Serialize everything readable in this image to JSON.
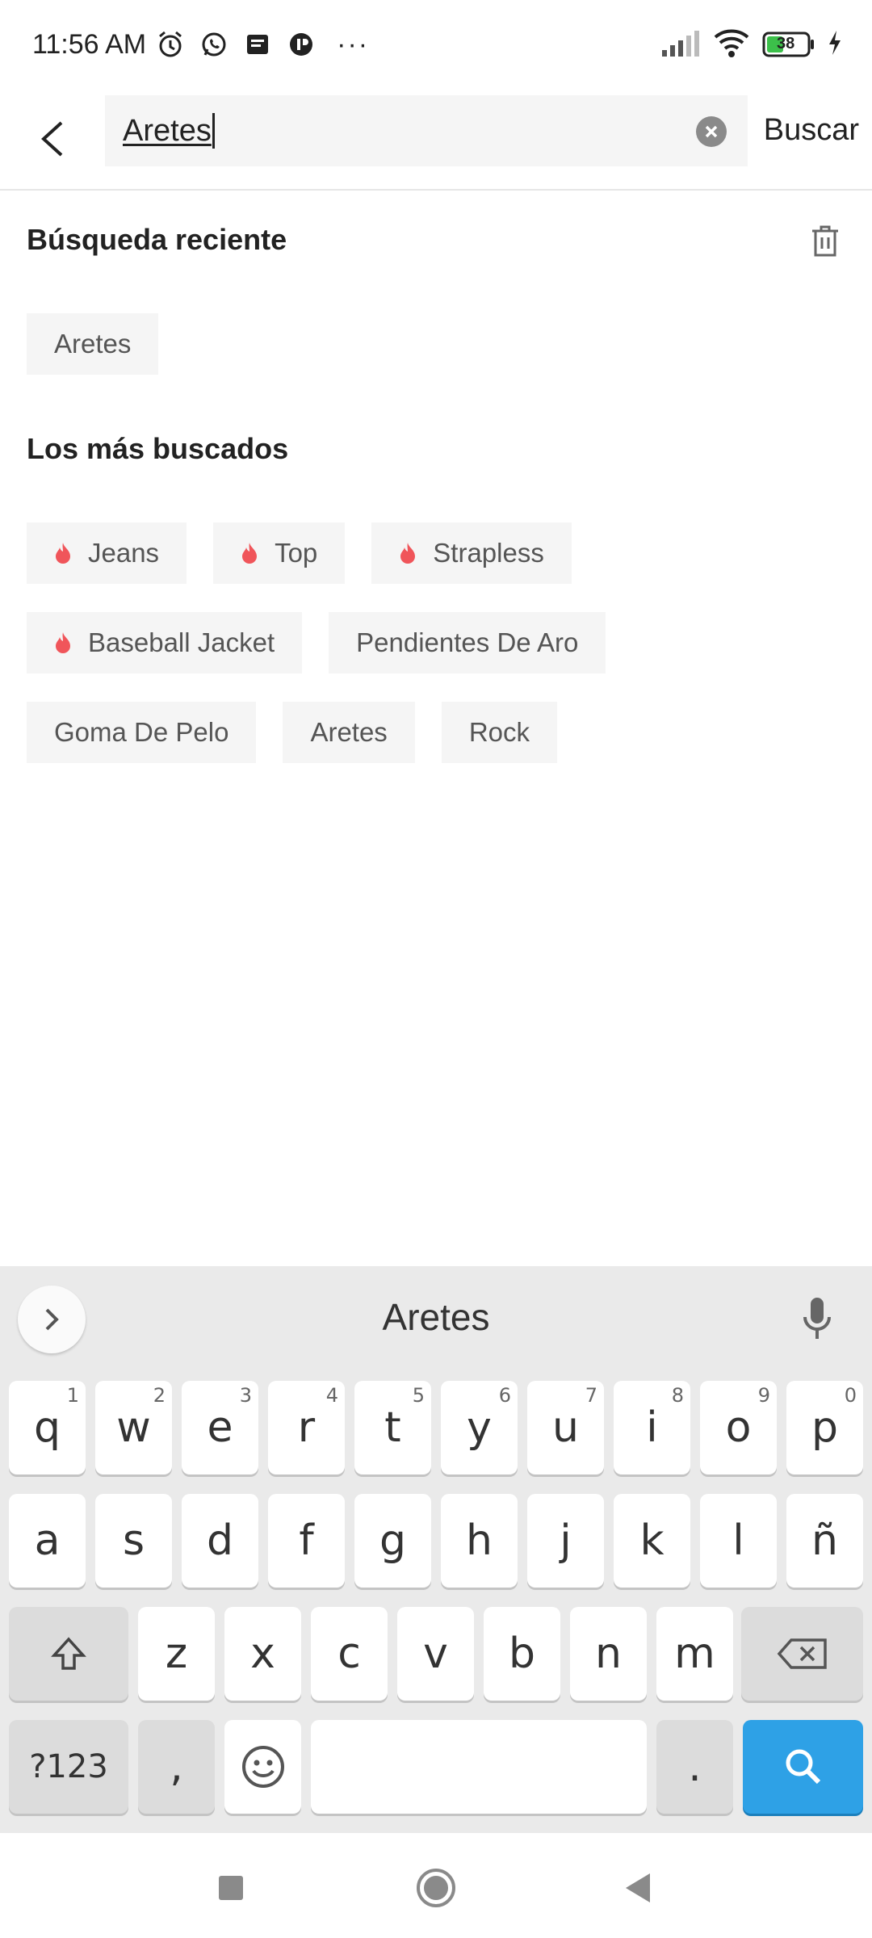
{
  "status_bar": {
    "time": "11:56 AM",
    "battery": "38",
    "more": "···"
  },
  "search": {
    "query": "Aretes",
    "submit_label": "Buscar"
  },
  "recent": {
    "title": "Búsqueda reciente",
    "items": [
      "Aretes"
    ]
  },
  "popular": {
    "title": "Los más buscados",
    "items": [
      {
        "label": "Jeans",
        "hot": true
      },
      {
        "label": "Top",
        "hot": true
      },
      {
        "label": "Strapless",
        "hot": true
      },
      {
        "label": "Baseball Jacket",
        "hot": true
      },
      {
        "label": "Pendientes De Aro",
        "hot": false
      },
      {
        "label": "Goma De Pelo",
        "hot": false
      },
      {
        "label": "Aretes",
        "hot": false
      },
      {
        "label": "Rock",
        "hot": false
      }
    ],
    "hot_color": "#f0555a"
  },
  "keyboard": {
    "suggestion": "Aretes",
    "row1": [
      {
        "k": "q",
        "n": "1"
      },
      {
        "k": "w",
        "n": "2"
      },
      {
        "k": "e",
        "n": "3"
      },
      {
        "k": "r",
        "n": "4"
      },
      {
        "k": "t",
        "n": "5"
      },
      {
        "k": "y",
        "n": "6"
      },
      {
        "k": "u",
        "n": "7"
      },
      {
        "k": "i",
        "n": "8"
      },
      {
        "k": "o",
        "n": "9"
      },
      {
        "k": "p",
        "n": "0"
      }
    ],
    "row2": [
      "a",
      "s",
      "d",
      "f",
      "g",
      "h",
      "j",
      "k",
      "l",
      "ñ"
    ],
    "row3": [
      "z",
      "x",
      "c",
      "v",
      "b",
      "n",
      "m"
    ],
    "symbols_label": "?123",
    "comma": ",",
    "period": ".",
    "accent_color": "#2ea1e6"
  }
}
